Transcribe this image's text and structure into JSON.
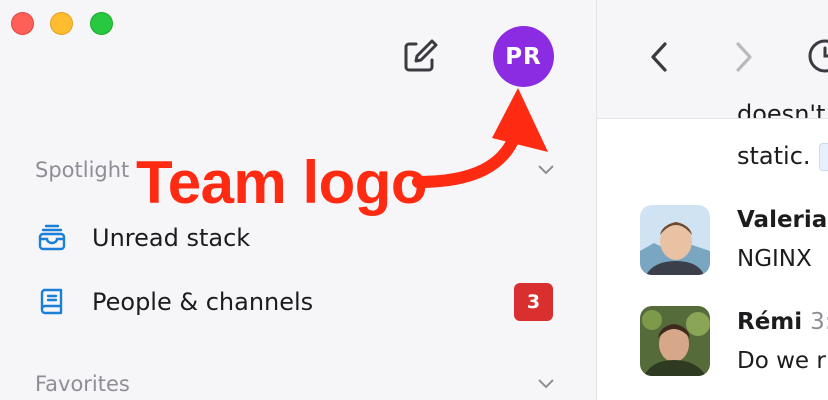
{
  "window": {
    "traffic_lights": [
      "close",
      "minimize",
      "zoom"
    ]
  },
  "header": {
    "compose_icon": "compose-icon",
    "team_avatar_initials": "PR",
    "team_avatar_color": "#8b2be2"
  },
  "sidebar": {
    "spotlight_label": "Spotlight",
    "favorites_label": "Favorites",
    "items": [
      {
        "label": "Unread stack",
        "icon": "inbox-tray-icon"
      },
      {
        "label": "People & channels",
        "icon": "book-icon",
        "badge": "3"
      }
    ]
  },
  "annotation": {
    "text": "Team logo",
    "color": "#ff2a12"
  },
  "conversation": {
    "partial_line": "doesn't",
    "static_line": "static.",
    "messages": [
      {
        "name": "Valeria",
        "time": "",
        "text": "NGINX"
      },
      {
        "name": "Rémi",
        "time": "3:",
        "text": "Do we r"
      }
    ]
  },
  "colors": {
    "badge": "#d92f2f",
    "accent_icon": "#1a7fd6"
  }
}
